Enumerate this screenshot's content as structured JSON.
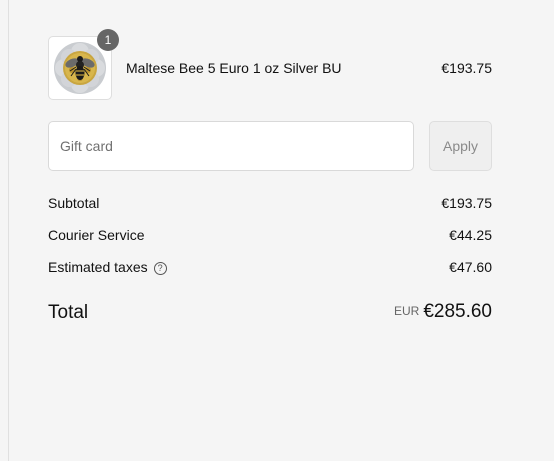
{
  "cart": {
    "items": [
      {
        "quantity": "1",
        "name": "Maltese Bee 5 Euro 1 oz Silver BU",
        "price": "€193.75",
        "image_icon": "bee-coin-icon"
      }
    ]
  },
  "gift_card": {
    "placeholder": "Gift card",
    "apply_label": "Apply"
  },
  "summary": {
    "subtotal_label": "Subtotal",
    "subtotal_value": "€193.75",
    "shipping_label": "Courier Service",
    "shipping_value": "€44.25",
    "taxes_label": "Estimated taxes",
    "taxes_help_glyph": "?",
    "taxes_value": "€47.60",
    "total_label": "Total",
    "currency_code": "EUR",
    "total_value": "€285.60"
  },
  "colors": {
    "background": "#f5f5f5",
    "badge": "#666666",
    "text": "#111111",
    "muted_text": "#707070"
  }
}
